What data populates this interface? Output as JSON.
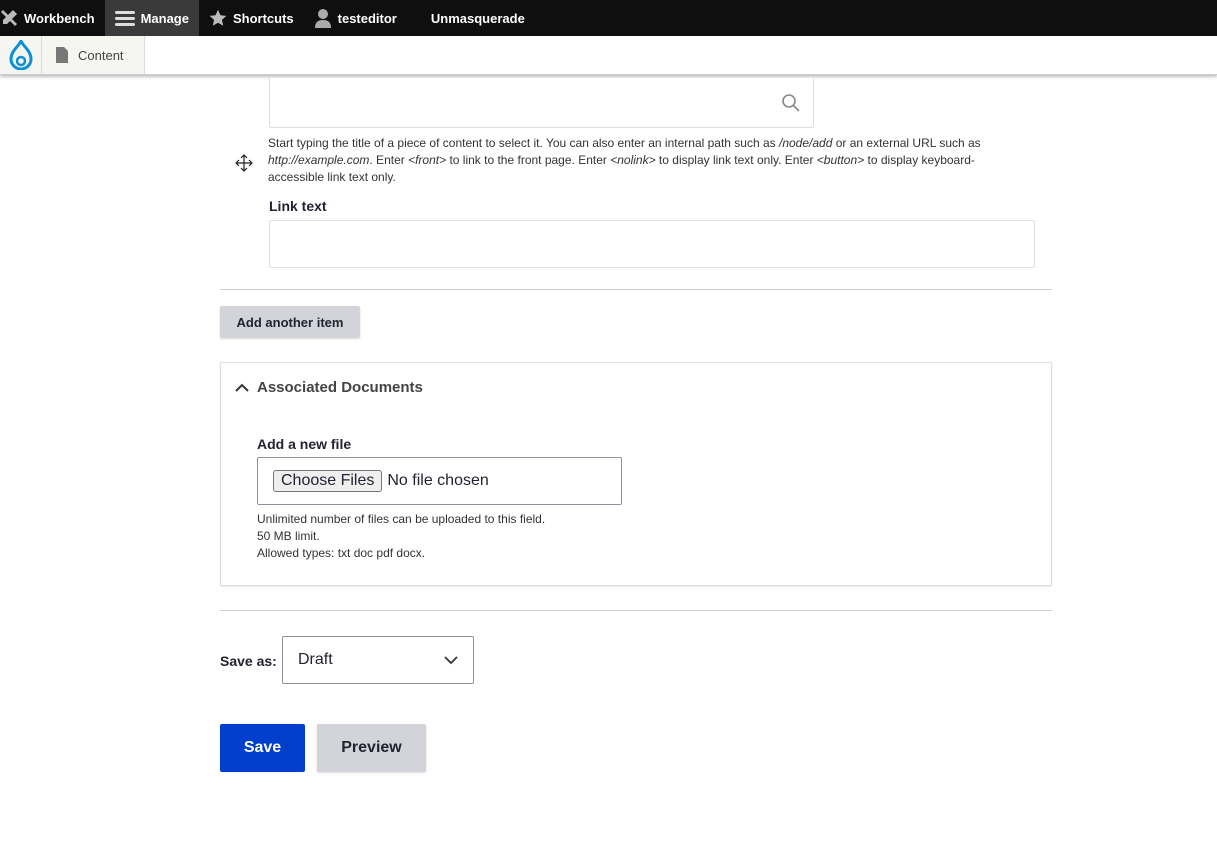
{
  "toolbar": {
    "workbench": "Workbench",
    "manage": "Manage",
    "shortcuts": "Shortcuts",
    "user": "testeditor",
    "unmasquerade": "Unmasquerade"
  },
  "secondary": {
    "content": "Content"
  },
  "link_field": {
    "url_value": "",
    "description": [
      {
        "t": "Start typing the title of a piece of content to select it. You can also enter an internal path such as ",
        "i": false
      },
      {
        "t": "/node/add",
        "i": true
      },
      {
        "t": " or an external URL such as ",
        "i": false
      },
      {
        "t": "http://example.com",
        "i": true
      },
      {
        "t": ". Enter ",
        "i": false
      },
      {
        "t": "<front>",
        "i": true
      },
      {
        "t": " to link to the front page. Enter ",
        "i": false
      },
      {
        "t": "<nolink>",
        "i": true
      },
      {
        "t": " to display link text only. Enter ",
        "i": false
      },
      {
        "t": "<button>",
        "i": true
      },
      {
        "t": " to display keyboard-accessible link text only.",
        "i": false
      }
    ],
    "link_text_label": "Link text",
    "link_text_value": ""
  },
  "add_another": "Add another item",
  "documents": {
    "title": "Associated Documents",
    "add_label": "Add a new file",
    "choose": "Choose Files",
    "no_file": "No file chosen",
    "help": [
      "Unlimited number of files can be uploaded to this field.",
      "50 MB limit.",
      "Allowed types: txt doc pdf docx."
    ]
  },
  "save_as": {
    "label": "Save as:",
    "value": "Draft"
  },
  "actions": {
    "save": "Save",
    "preview": "Preview"
  },
  "colors": {
    "primary": "#003ecc",
    "toolbar": "#0f0f0f",
    "drupal_blue": "#0a8fd8"
  }
}
